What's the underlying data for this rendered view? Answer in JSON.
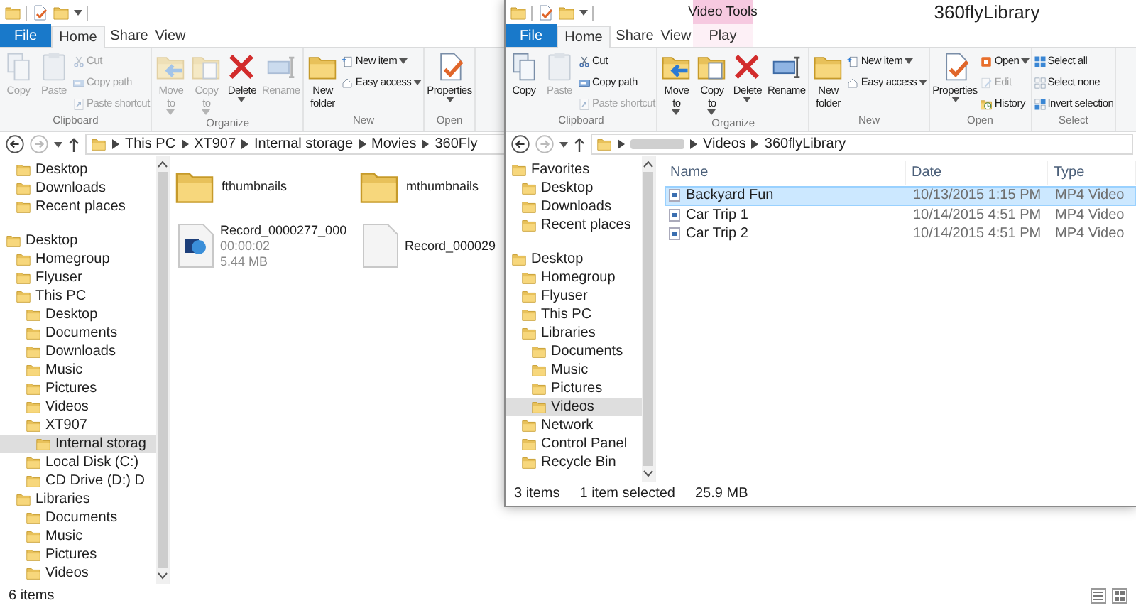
{
  "left_window": {
    "tabs": [
      {
        "label": "File",
        "kind": "file",
        "selected": false
      },
      {
        "label": "Home",
        "kind": "tab",
        "selected": true
      },
      {
        "label": "Share",
        "kind": "tab",
        "selected": false
      },
      {
        "label": "View",
        "kind": "tab",
        "selected": false
      }
    ],
    "ribbon": [
      {
        "label": "Clipboard",
        "buttons": [
          {
            "label": "Copy",
            "kind": "large",
            "disabled": true,
            "dropdown": false
          },
          {
            "label": "Paste",
            "kind": "large",
            "disabled": true,
            "dropdown": false
          },
          {
            "label": "Cut",
            "kind": "small",
            "disabled": true,
            "dropdown": false
          },
          {
            "label": "Copy path",
            "kind": "small",
            "disabled": true,
            "dropdown": false
          },
          {
            "label": "Paste shortcut",
            "kind": "small",
            "disabled": true,
            "dropdown": false
          }
        ]
      },
      {
        "label": "Organize",
        "buttons": [
          {
            "label": "Move to",
            "kind": "large",
            "disabled": true,
            "dropdown": true
          },
          {
            "label": "Copy to",
            "kind": "large",
            "disabled": true,
            "dropdown": true
          },
          {
            "label": "Delete",
            "kind": "large",
            "disabled": false,
            "dropdown": true
          },
          {
            "label": "Rename",
            "kind": "large",
            "disabled": true,
            "dropdown": false
          }
        ]
      },
      {
        "label": "New",
        "buttons": [
          {
            "label": "New folder",
            "kind": "large",
            "disabled": false,
            "dropdown": false
          },
          {
            "label": "New item",
            "kind": "small",
            "disabled": false,
            "dropdown": true
          },
          {
            "label": "Easy access",
            "kind": "small",
            "disabled": false,
            "dropdown": true
          }
        ]
      },
      {
        "label": "Open",
        "buttons": [
          {
            "label": "Properties",
            "kind": "large",
            "disabled": false,
            "dropdown": true
          }
        ]
      }
    ],
    "path": [
      {
        "kind": "folder",
        "label": "This PC"
      },
      {
        "kind": "folder",
        "label": "XT907"
      },
      {
        "kind": "folder",
        "label": "Internal storage"
      },
      {
        "kind": "folder",
        "label": "Movies"
      },
      {
        "kind": "folder",
        "label": "360Fly"
      }
    ],
    "navigation": [
      [
        {
          "children": [
            {
              "label": "Desktop",
              "selected": false
            },
            {
              "label": "Downloads",
              "selected": false
            },
            {
              "label": "Recent places",
              "selected": false
            }
          ]
        }
      ],
      [
        {
          "label": "Desktop",
          "selected": false,
          "children": [
            {
              "label": "Homegroup",
              "selected": false
            },
            {
              "label": "Flyuser",
              "selected": false
            },
            {
              "label": "This PC",
              "selected": false,
              "children": [
                {
                  "label": "Desktop",
                  "selected": false
                },
                {
                  "label": "Documents",
                  "selected": false
                },
                {
                  "label": "Downloads",
                  "selected": false
                },
                {
                  "label": "Music",
                  "selected": false
                },
                {
                  "label": "Pictures",
                  "selected": false
                },
                {
                  "label": "Videos",
                  "selected": false
                },
                {
                  "label": "XT907",
                  "selected": false,
                  "children": [
                    {
                      "label": "Internal storag",
                      "selected": true
                    }
                  ]
                },
                {
                  "label": "Local Disk (C:)",
                  "selected": false
                },
                {
                  "label": "CD Drive (D:) D",
                  "selected": false
                }
              ]
            },
            {
              "label": "Libraries",
              "selected": false,
              "children": [
                {
                  "label": "Documents",
                  "selected": false
                },
                {
                  "label": "Music",
                  "selected": false
                },
                {
                  "label": "Pictures",
                  "selected": false
                },
                {
                  "label": "Videos",
                  "selected": false
                }
              ]
            }
          ]
        }
      ]
    ],
    "content": {
      "kind": "tiles",
      "items": [
        {
          "kind": "folder",
          "name": "fthumbnails"
        },
        {
          "kind": "folder",
          "name": "mthumbnails"
        },
        {
          "kind": "video",
          "name": "Record_0000277_000",
          "details": [
            "00:00:02",
            "5.44 MB"
          ]
        },
        {
          "kind": "file",
          "name": "Record_000029"
        }
      ]
    },
    "status_bar": [
      "6 items"
    ]
  },
  "right_window": {
    "title": "360flyLibrary",
    "contextual_tab": "Video Tools",
    "tabs": [
      {
        "label": "File",
        "kind": "file",
        "selected": false
      },
      {
        "label": "Home",
        "kind": "tab",
        "selected": true
      },
      {
        "label": "Share",
        "kind": "tab",
        "selected": false
      },
      {
        "label": "View",
        "kind": "tab",
        "selected": false
      },
      {
        "label": "Play",
        "kind": "contextual",
        "selected": false
      }
    ],
    "ribbon": [
      {
        "label": "Clipboard",
        "buttons": [
          {
            "label": "Copy",
            "kind": "large",
            "disabled": false,
            "dropdown": false
          },
          {
            "label": "Paste",
            "kind": "large",
            "disabled": true,
            "dropdown": false
          },
          {
            "label": "Cut",
            "kind": "small",
            "disabled": false,
            "dropdown": false
          },
          {
            "label": "Copy path",
            "kind": "small",
            "disabled": false,
            "dropdown": false
          },
          {
            "label": "Paste shortcut",
            "kind": "small",
            "disabled": true,
            "dropdown": false
          }
        ]
      },
      {
        "label": "Organize",
        "buttons": [
          {
            "label": "Move to",
            "kind": "large",
            "disabled": false,
            "dropdown": true
          },
          {
            "label": "Copy to",
            "kind": "large",
            "disabled": false,
            "dropdown": true
          },
          {
            "label": "Delete",
            "kind": "large",
            "disabled": false,
            "dropdown": true
          },
          {
            "label": "Rename",
            "kind": "large",
            "disabled": false,
            "dropdown": false
          }
        ]
      },
      {
        "label": "New",
        "buttons": [
          {
            "label": "New folder",
            "kind": "large",
            "disabled": false,
            "dropdown": false
          },
          {
            "label": "New item",
            "kind": "small",
            "disabled": false,
            "dropdown": true
          },
          {
            "label": "Easy access",
            "kind": "small",
            "disabled": false,
            "dropdown": true
          }
        ]
      },
      {
        "label": "Open",
        "buttons": [
          {
            "label": "Properties",
            "kind": "large",
            "disabled": false,
            "dropdown": true
          },
          {
            "label": "Open",
            "kind": "small",
            "disabled": false,
            "dropdown": true
          },
          {
            "label": "Edit",
            "kind": "small",
            "disabled": true,
            "dropdown": false
          },
          {
            "label": "History",
            "kind": "small",
            "disabled": false,
            "dropdown": false
          }
        ]
      },
      {
        "label": "Select",
        "buttons": [
          {
            "label": "Select all",
            "kind": "small",
            "disabled": false,
            "dropdown": false
          },
          {
            "label": "Select none",
            "kind": "small",
            "disabled": false,
            "dropdown": false
          },
          {
            "label": "Invert selection",
            "kind": "small",
            "disabled": false,
            "dropdown": false
          }
        ]
      }
    ],
    "path": [
      {
        "kind": "blurred"
      },
      {
        "kind": "folder",
        "label": "Videos"
      },
      {
        "kind": "folder",
        "label": "360flyLibrary"
      }
    ],
    "navigation": [
      [
        {
          "label": "Favorites",
          "selected": false,
          "children": [
            {
              "label": "Desktop",
              "selected": false
            },
            {
              "label": "Downloads",
              "selected": false
            },
            {
              "label": "Recent places",
              "selected": false
            }
          ]
        }
      ],
      [
        {
          "label": "Desktop",
          "selected": false,
          "children": [
            {
              "label": "Homegroup",
              "selected": false
            },
            {
              "label": "Flyuser",
              "selected": false
            },
            {
              "label": "This PC",
              "selected": false
            },
            {
              "label": "Libraries",
              "selected": false,
              "children": [
                {
                  "label": "Documents",
                  "selected": false
                },
                {
                  "label": "Music",
                  "selected": false
                },
                {
                  "label": "Pictures",
                  "selected": false
                },
                {
                  "label": "Videos",
                  "selected": true
                }
              ]
            },
            {
              "label": "Network",
              "selected": false
            },
            {
              "label": "Control Panel",
              "selected": false
            },
            {
              "label": "Recycle Bin",
              "selected": false
            }
          ]
        }
      ]
    ],
    "content": {
      "kind": "details",
      "columns": [
        "Name",
        "Date",
        "Type"
      ],
      "rows": [
        {
          "name": "Backyard Fun",
          "date": "10/13/2015 1:15 PM",
          "type": "MP4 Video",
          "selected": true
        },
        {
          "name": "Car Trip 1",
          "date": "10/14/2015 4:51 PM",
          "type": "MP4 Video",
          "selected": false
        },
        {
          "name": "Car Trip 2",
          "date": "10/14/2015 4:51 PM",
          "type": "MP4 Video",
          "selected": false
        }
      ]
    },
    "status_bar": [
      "3 items",
      "1 item selected",
      "25.9 MB"
    ]
  }
}
